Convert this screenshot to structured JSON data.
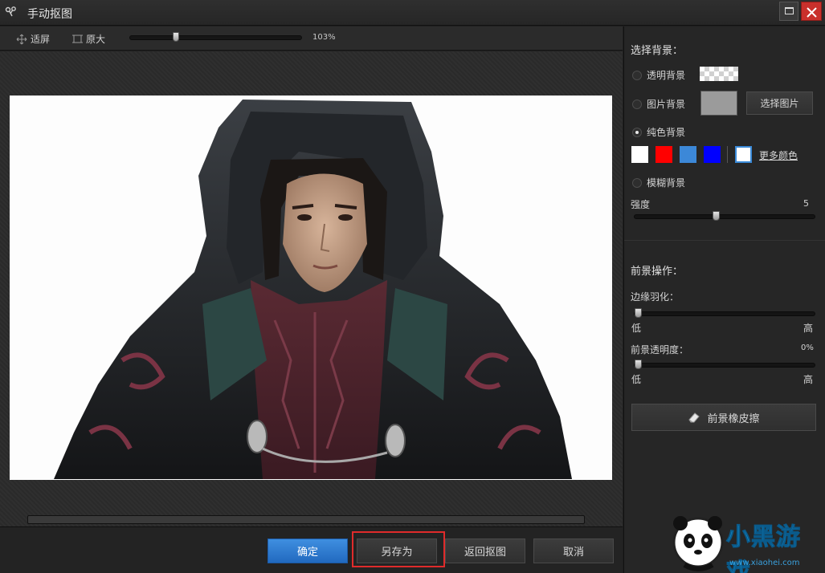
{
  "window": {
    "title": "手动抠图"
  },
  "toolbar": {
    "fit_label": "适屏",
    "original_label": "原大",
    "zoom_value": "103%",
    "zoom_fraction": 0.26
  },
  "footer": {
    "ok_label": "确定",
    "save_as_label": "另存为",
    "back_label": "返回抠图",
    "cancel_label": "取消"
  },
  "panel": {
    "background_title": "选择背景：",
    "transparent_label": "透明背景",
    "image_bg_label": "图片背景",
    "choose_image_label": "选择图片",
    "solid_label": "纯色背景",
    "solid_selected": true,
    "swatch_colors": [
      "#ffffff",
      "#ff0000",
      "#3c88d8",
      "#0000ff"
    ],
    "more_colors_label": "更多颜色",
    "blur_label": "模糊背景",
    "strength_label": "强度",
    "strength_value": "5",
    "strength_fraction": 0.45,
    "foreground_title": "前景操作：",
    "feather_label": "边缘羽化：",
    "feather_low": "低",
    "feather_high": "高",
    "feather_fraction": 0.0,
    "opacity_label": "前景透明度：",
    "opacity_value": "0%",
    "opacity_low": "低",
    "opacity_high": "高",
    "opacity_fraction": 0.0,
    "eraser_label": "前景橡皮擦"
  },
  "watermark": {
    "logo_text": "小黑游戏",
    "url": "www.xiaohei.com"
  },
  "colors": {
    "accent": "#2f7fd6",
    "highlight": "#e02b2b"
  },
  "icons": [
    "scissors-icon",
    "fit-screen-icon",
    "original-size-icon",
    "maximize-icon",
    "close-icon",
    "eraser-icon"
  ]
}
